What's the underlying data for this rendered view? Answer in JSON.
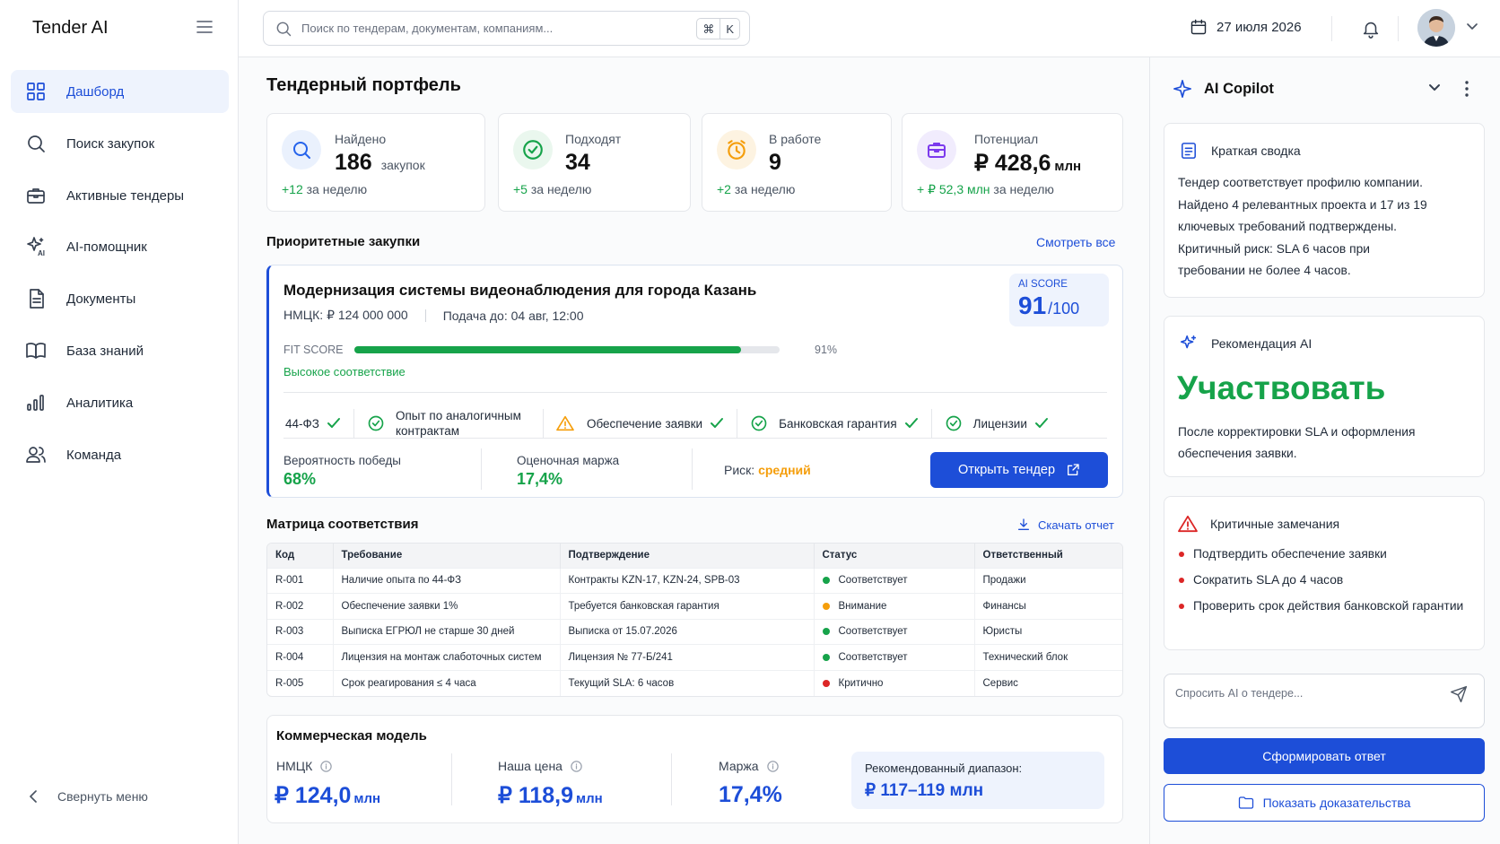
{
  "app": {
    "name": "Tender AI"
  },
  "sidebar": {
    "items": [
      {
        "label": "Дашборд",
        "icon": "grid-icon",
        "active": true
      },
      {
        "label": "Поиск закупок",
        "icon": "search-icon"
      },
      {
        "label": "Активные тендеры",
        "icon": "briefcase-icon"
      },
      {
        "label": "AI-помощник",
        "icon": "sparkle-ai-icon"
      },
      {
        "label": "Документы",
        "icon": "document-icon"
      },
      {
        "label": "База знаний",
        "icon": "book-icon"
      },
      {
        "label": "Аналитика",
        "icon": "bar-chart-icon"
      },
      {
        "label": "Команда",
        "icon": "users-icon"
      }
    ],
    "collapse_label": "Свернуть меню"
  },
  "topbar": {
    "search_placeholder": "Поиск по тендерам, документам, компаниям...",
    "shortcut": [
      "⌘",
      "K"
    ],
    "date": "27 июля 2026"
  },
  "dashboard": {
    "title": "Тендерный портфель",
    "kpis": [
      {
        "label": "Найдено",
        "value": "186",
        "unit": "закупок",
        "delta_value": "+12",
        "delta_text": "за неделю",
        "icon": "search-icon",
        "color": "#2563eb",
        "bg": "#eaf1fd"
      },
      {
        "label": "Подходят",
        "value": "34",
        "unit": "",
        "delta_value": "+5",
        "delta_text": "за неделю",
        "icon": "check-circle-icon",
        "color": "#16a34a",
        "bg": "#eaf7ee"
      },
      {
        "label": "В работе",
        "value": "9",
        "unit": "",
        "delta_value": "+2",
        "delta_text": "за неделю",
        "icon": "alarm-clock-icon",
        "color": "#f59e0b",
        "bg": "#fdf3e1"
      },
      {
        "label": "Потенциал",
        "value": "₽ 428,6",
        "unit": "млн",
        "delta_value": "+ ₽ 52,3 млн",
        "delta_text": "за неделю",
        "icon": "briefcase-icon",
        "color": "#7c3aed",
        "bg": "#f1ecfd"
      }
    ],
    "priority": {
      "title": "Приоритетные закупки",
      "view_all": "Смотреть все",
      "tender": {
        "title": "Модернизация системы видеонаблюдения для города Казань",
        "nmck": "НМЦК: ₽ 124 000 000",
        "deadline": "Подача до: 04 авг, 12:00",
        "ai_score_label": "AI SCORE",
        "ai_score": "91",
        "ai_score_max": "/100",
        "fit_label": "FIT SCORE",
        "fit_value": 91,
        "fit_text": "91%",
        "fit_caption": "Высокое соответствие",
        "checks": [
          {
            "label": "44-ФЗ",
            "state": "ok"
          },
          {
            "label": "Опыт по аналогичным контрактам",
            "state": "ok"
          },
          {
            "label": "Обеспечение заявки",
            "state": "warn"
          },
          {
            "label": "Банковская гарантия",
            "state": "ok"
          },
          {
            "label": "Лицензии",
            "state": "ok"
          }
        ],
        "win_label": "Вероятность победы",
        "win_value": "68%",
        "margin_label": "Оценочная маржа",
        "margin_value": "17,4%",
        "risk_label": "Риск:",
        "risk_value": "средний",
        "open_button": "Открыть тендер"
      }
    },
    "matrix": {
      "title": "Матрица соответствия",
      "download": "Скачать отчет",
      "columns": [
        "Код",
        "Требование",
        "Подтверждение",
        "Статус",
        "Ответственный"
      ],
      "rows": [
        [
          "R-001",
          "Наличие опыта по 44-ФЗ",
          "Контракты KZN-17, KZN-24, SPB-03",
          "Соответствует",
          "Продажи"
        ],
        [
          "R-002",
          "Обеспечение заявки 1%",
          "Требуется банковская гарантия",
          "Внимание",
          "Финансы"
        ],
        [
          "R-003",
          "Выписка ЕГРЮЛ не старше 30 дней",
          "Выписка от 15.07.2026",
          "Соответствует",
          "Юристы"
        ],
        [
          "R-004",
          "Лицензия на монтаж слаботочных систем",
          "Лицензия № 77-Б/241",
          "Соответствует",
          "Технический блок"
        ],
        [
          "R-005",
          "Срок реагирования ≤ 4 часа",
          "Текущий SLA: 6 часов",
          "Критично",
          "Сервис"
        ]
      ],
      "status_colors": {
        "Соответствует": "#16a34a",
        "Внимание": "#f59e0b",
        "Критично": "#dc2626"
      }
    },
    "commercial": {
      "title": "Коммерческая модель",
      "items": [
        {
          "label": "НМЦК",
          "value": "₽ 124,0",
          "unit": "млн"
        },
        {
          "label": "Наша цена",
          "value": "₽ 118,9",
          "unit": "млн"
        },
        {
          "label": "Маржа",
          "value": "17,4%",
          "unit": ""
        }
      ],
      "range_label": "Рекомендованный диапазон:",
      "range_value": "₽ 117–119",
      "range_unit": "млн"
    }
  },
  "copilot": {
    "title": "AI Copilot",
    "summary_title": "Краткая сводка",
    "summary_lines": [
      "Тендер соответствует профилю компании.",
      "Найдено 4 релевантных проекта и 17 из 19",
      "ключевых требований подтверждены.",
      "Критичный риск: SLA 6 часов при",
      "требовании не более 4 часов."
    ],
    "rec_title": "Рекомендация AI",
    "rec_value": "Участвовать",
    "rec_lines": [
      "После корректировки SLA и оформления",
      "обеспечения заявки."
    ],
    "issues_title": "Критичные замечания",
    "issues": [
      "Подтвердить обеспечение заявки",
      "Сократить SLA до 4 часов",
      "Проверить срок действия банковской гарантии"
    ],
    "ask_placeholder": "Спросить AI о тендере...",
    "generate_button": "Сформировать ответ",
    "evidence_button": "Показать доказательства"
  },
  "colors": {
    "accent": "#1d4ed8",
    "success": "#16a34a",
    "warning": "#f59e0b",
    "danger": "#dc2626"
  }
}
